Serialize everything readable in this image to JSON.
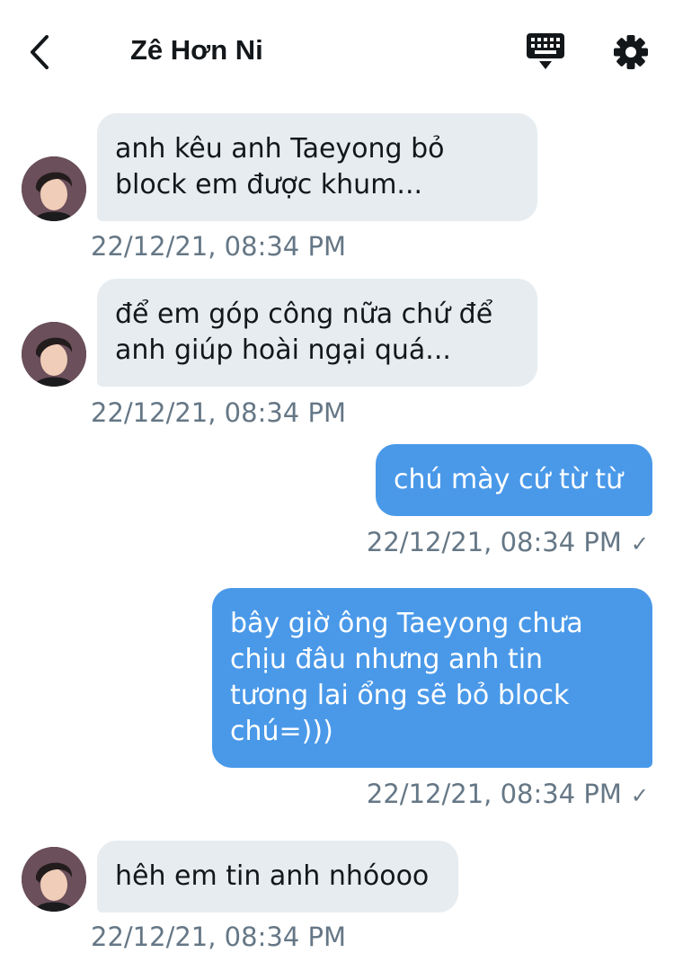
{
  "header": {
    "title": "Zê Hơn Ni",
    "back_icon": "chevron-left-icon",
    "keyboard_icon": "keyboard-icon",
    "settings_icon": "gear-icon"
  },
  "colors": {
    "incoming_bubble": "#e6ecf0",
    "outgoing_bubble": "#4a99e9",
    "timestamp": "#657786"
  },
  "messages": [
    {
      "direction": "in",
      "lines": [
        "anh kêu anh Taeyong bỏ",
        "block em được khum..."
      ],
      "time": "22/12/21, 08:34 PM"
    },
    {
      "direction": "in",
      "lines": [
        "để em góp công nữa chứ để",
        "anh giúp hoài ngại quá..."
      ],
      "time": "22/12/21, 08:34 PM"
    },
    {
      "direction": "out",
      "lines": [
        "chú mày cứ từ từ"
      ],
      "time": "22/12/21, 08:34 PM",
      "read_mark": "✓"
    },
    {
      "direction": "out",
      "lines": [
        "bây giờ ông Taeyong chưa",
        "chịu đâu nhưng anh tin",
        "tương lai ổng sẽ bỏ block",
        "chú=)))"
      ],
      "time": "22/12/21, 08:34 PM",
      "read_mark": "✓"
    },
    {
      "direction": "in",
      "lines": [
        "hêh em tin anh nhóooo"
      ],
      "time": "22/12/21, 08:34 PM"
    }
  ]
}
